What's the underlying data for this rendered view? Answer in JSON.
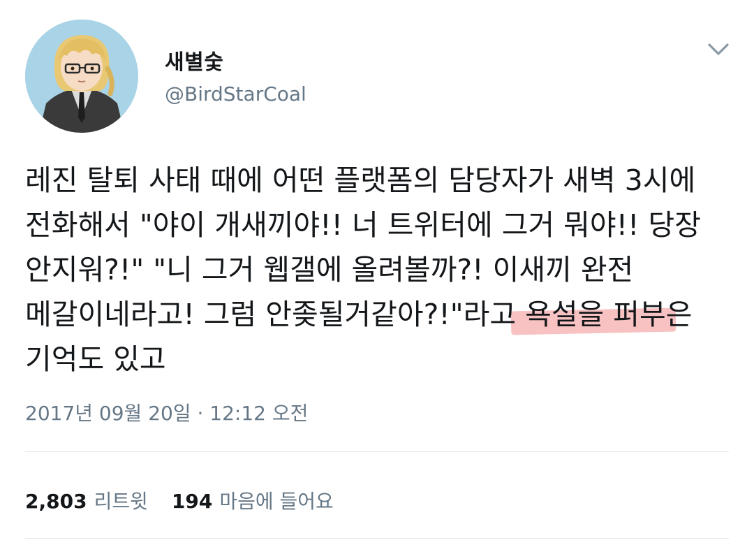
{
  "author": {
    "display_name": "새별숯",
    "username": "@BirdStarCoal"
  },
  "tweet": {
    "text_before_highlight": "레진 탈퇴 사태 때에 어떤 플랫폼의 담당자가 새벽 3시에 전화해서 \"야이 개새끼야!! 너 트위터에 그거 뭐야!! 당장 안지워?!\" \"니 그거 웹갤에 올려볼까?! 이새끼 완전 메갈이네라고! 그럼 안좆될거같아?!\"라고",
    "highlighted_text": " 욕설을 퍼부은",
    "text_after_highlight": " 기억도 있고",
    "highlight_color": "#f07878",
    "timestamp": "2017년 09월 20일 · 12:12 오전"
  },
  "stats": {
    "retweets_count": "2,803",
    "retweets_label": "리트윗",
    "likes_count": "194",
    "likes_label": "마음에 들어요"
  },
  "icons": {
    "menu": "chevron-down-icon",
    "avatar": "avatar-illustration"
  },
  "colors": {
    "secondary_text": "#657786",
    "primary_text": "#14171a",
    "avatar_bg": "#a9d3e6"
  }
}
